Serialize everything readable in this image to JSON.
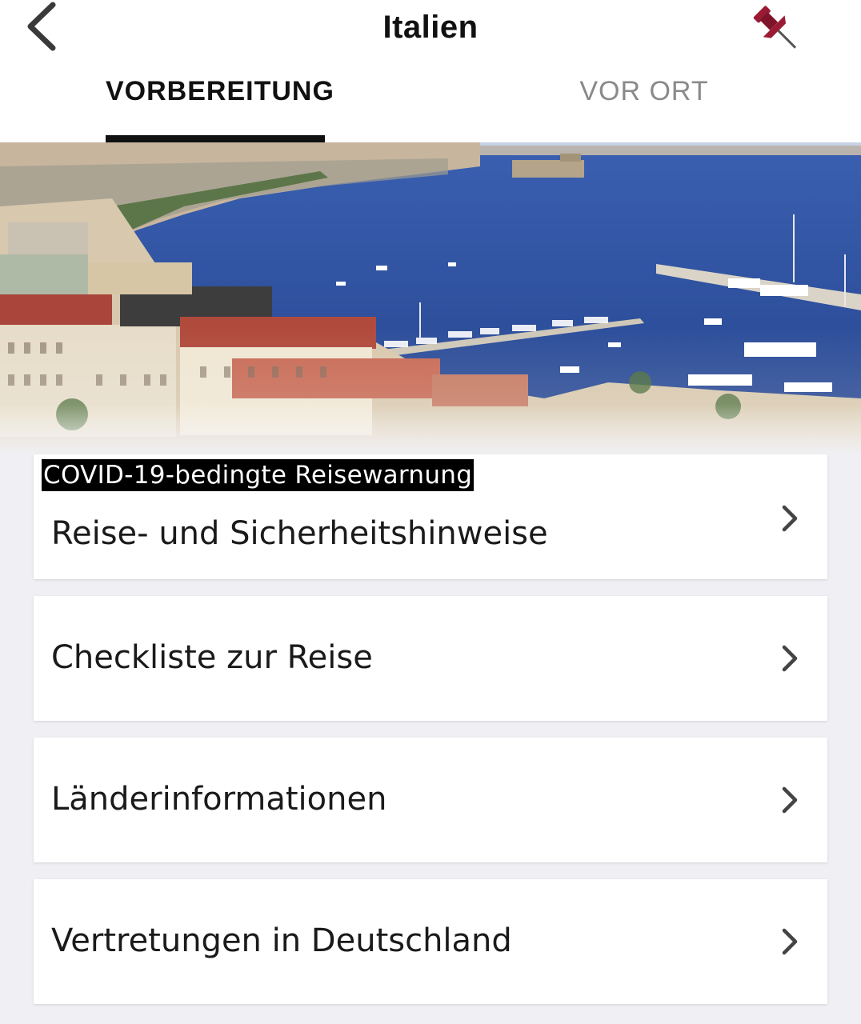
{
  "header": {
    "title": "Italien",
    "back_icon": "chevron-left-icon",
    "pin_icon": "pushpin-icon",
    "pin_color": "#9b1b35"
  },
  "tabs": [
    {
      "label": "VORBEREITUNG",
      "active": true
    },
    {
      "label": "VOR ORT",
      "active": false
    }
  ],
  "warning_badge": "COVID-19-bedingte Reisewarnung",
  "menu": [
    {
      "label": "Reise- und Sicherheitshinweise",
      "icon": "chevron-right-icon"
    },
    {
      "label": "Checkliste zur Reise",
      "icon": "chevron-right-icon"
    },
    {
      "label": "Länderinformationen",
      "icon": "chevron-right-icon"
    },
    {
      "label": "Vertretungen in Deutschland",
      "icon": "chevron-right-icon"
    }
  ],
  "colors": {
    "background": "#f0f0f4",
    "active_tab": "#111111",
    "inactive_tab": "#8a8a8a",
    "sea": "#2a4a9a"
  }
}
